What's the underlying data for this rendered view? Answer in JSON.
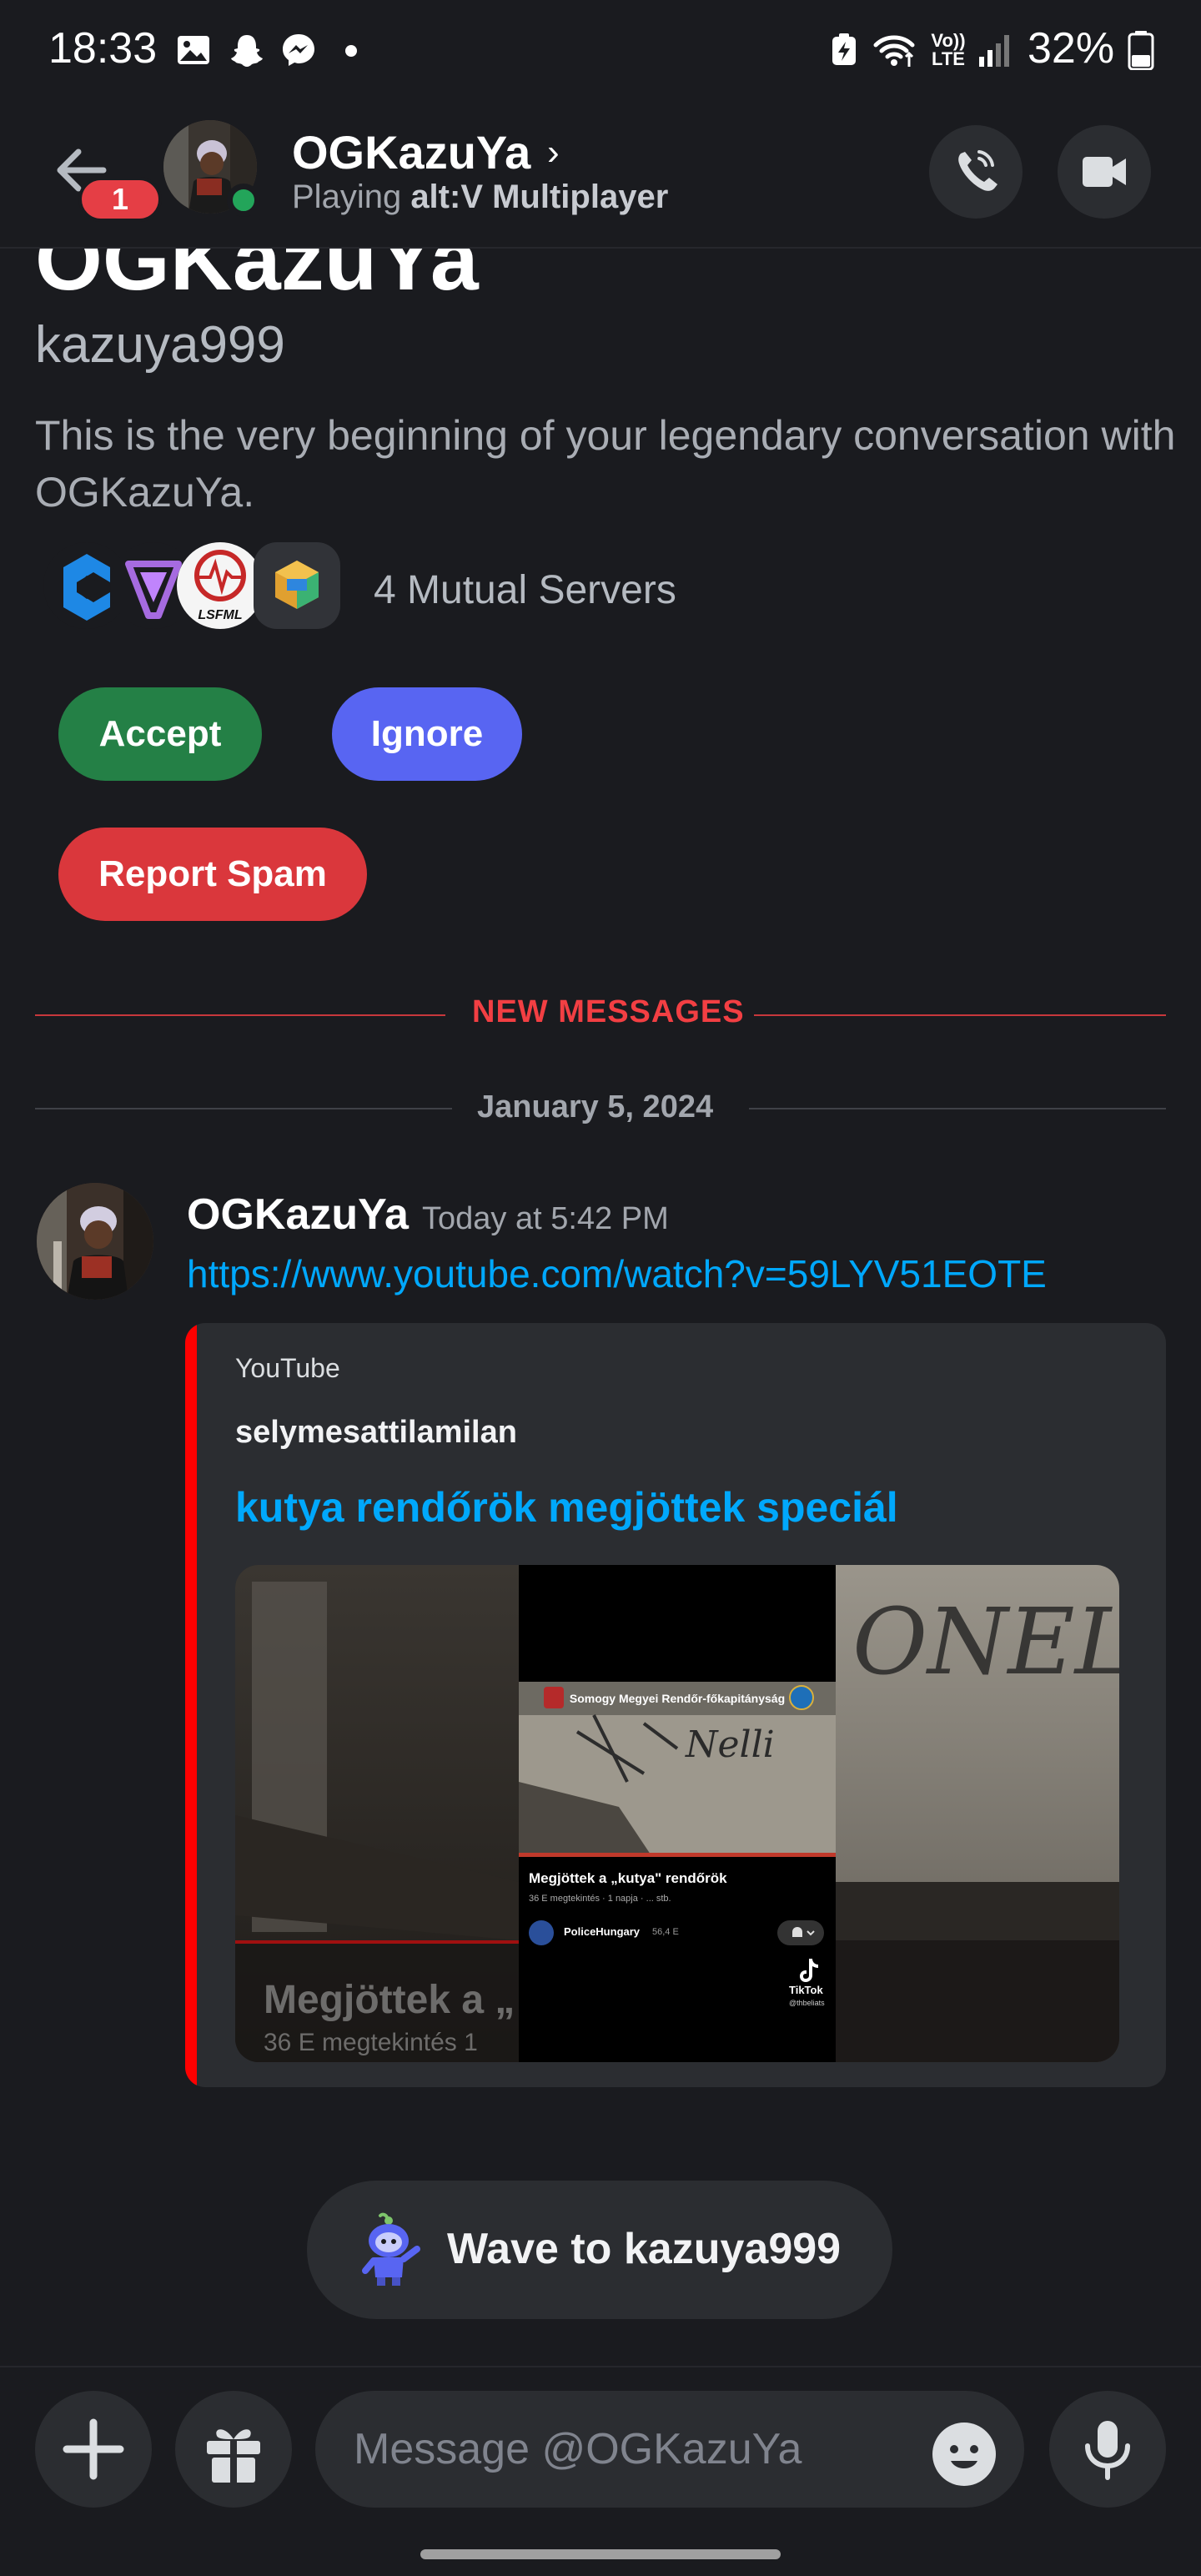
{
  "status_bar": {
    "time": "18:33",
    "battery_percent": "32%",
    "network_label": "Vo)) LTE"
  },
  "header": {
    "back_badge": "1",
    "name": "OGKazuYa",
    "chevron": "›",
    "status_prefix": "Playing ",
    "status_game": "alt:V Multiplayer"
  },
  "intro": {
    "display_name": "OGKazuYa",
    "username": "kazuya999",
    "description": "This is the very beginning of your legendary conversation with OGKazuYa.",
    "mutual_servers_label": "4 Mutual Servers",
    "server_icon_text": "LSFML"
  },
  "actions": {
    "accept": "Accept",
    "ignore": "Ignore",
    "report_spam": "Report Spam"
  },
  "dividers": {
    "new_messages": "NEW MESSAGES",
    "date": "January 5, 2024"
  },
  "message": {
    "author": "OGKazuYa",
    "timestamp": "Today at 5:42 PM",
    "link": "https://www.youtube.com/watch?v=59LYV51EOTE"
  },
  "embed": {
    "provider": "YouTube",
    "author": "selymesattilamilan",
    "title": "kutya rendőrök megjöttek speciál",
    "thumb_header": "Somogy Megyei Rendőr-főkapitányság",
    "thumb_caption": "Megjöttek a „kutya\" rendőrök",
    "thumb_meta": "36 E megtekintés · 1 napja · ... stb.",
    "thumb_channel": "PoliceHungary",
    "thumb_subs": "56,4 E",
    "thumb_tiktok": "TikTok",
    "thumb_handle": "@thbeliats",
    "thumb_big_caption": "Megjöttek a „",
    "thumb_big_meta": "36 E megtekintés  1"
  },
  "wave": {
    "label": "Wave to kazuya999"
  },
  "composer": {
    "placeholder": "Message @OGKazuYa"
  },
  "colors": {
    "background": "#1a1b1f",
    "accept": "#248046",
    "ignore": "#5865f2",
    "report_spam": "#da373c",
    "new_messages": "#f23f43",
    "link": "#00a8fc",
    "embed_bar": "#ff0000",
    "online": "#23a55a"
  },
  "icons": {
    "back": "arrow-left-icon",
    "call": "phone-call-icon",
    "video": "video-camera-icon",
    "plus": "plus-icon",
    "gift": "gift-icon",
    "emoji": "emoji-icon",
    "mic": "microphone-icon",
    "wave": "wumpus-wave-icon"
  }
}
